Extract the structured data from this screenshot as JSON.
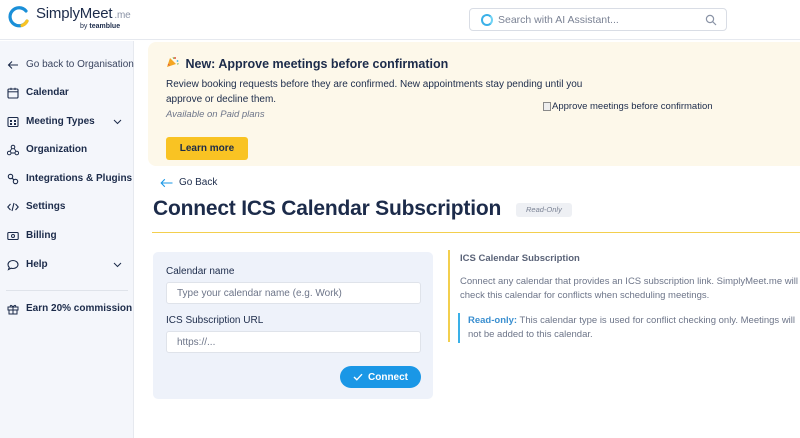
{
  "brand": {
    "name": "SimplyMeet",
    "suffix": ".me",
    "by_prefix": "by",
    "by_name": "teamblue"
  },
  "search": {
    "placeholder": "Search with AI Assistant..."
  },
  "sidebar": {
    "items": [
      {
        "label": "Go back to Organisation",
        "icon": "arrow-left-icon"
      },
      {
        "label": "Calendar",
        "icon": "calendar-icon"
      },
      {
        "label": "Meeting Types",
        "icon": "meeting-types-icon"
      },
      {
        "label": "Organization",
        "icon": "organization-icon"
      },
      {
        "label": "Integrations & Plugins",
        "icon": "plugins-icon"
      },
      {
        "label": "Settings",
        "icon": "code-icon"
      },
      {
        "label": "Billing",
        "icon": "billing-icon"
      },
      {
        "label": "Help",
        "icon": "chat-icon"
      },
      {
        "label": "Earn 20% commission",
        "icon": "gift-icon"
      }
    ]
  },
  "banner": {
    "title": "New: Approve meetings before confirmation",
    "description": "Review booking requests before they are confirmed. New appointments stay pending until you approve or decline them.",
    "availability": "Available on Paid plans",
    "button": "Learn more",
    "image_alt": "Approve meetings before confirmation"
  },
  "page": {
    "back": "Go Back",
    "title": "Connect ICS Calendar Subscription",
    "badge": "Read-Only"
  },
  "form": {
    "name_label": "Calendar name",
    "name_placeholder": "Type your calendar name (e.g. Work)",
    "url_label": "ICS Subscription URL",
    "url_placeholder": "https://...",
    "submit": "Connect"
  },
  "info": {
    "title": "ICS Calendar Subscription",
    "text": "Connect any calendar that provides an ICS subscription link. SimplyMeet.me will check this calendar for conflicts when scheduling meetings.",
    "note_bold": "Read-only:",
    "note_text": " This calendar type is used for conflict checking only. Meetings will not be added to this calendar."
  },
  "colors": {
    "accent": "#1a97e6",
    "highlight": "#f9c323",
    "banner_bg": "#fdf8ea",
    "text": "#1c2b4a"
  }
}
